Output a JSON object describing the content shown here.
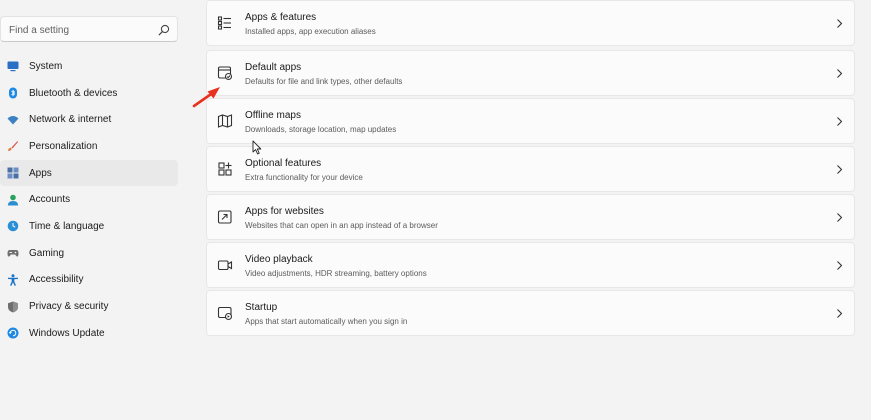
{
  "search": {
    "placeholder": "Find a setting",
    "icon": "search-icon"
  },
  "sidebar": {
    "items": [
      {
        "label": "System",
        "icon": "monitor-icon",
        "color": "#2a6fc4"
      },
      {
        "label": "Bluetooth & devices",
        "icon": "bluetooth-icon",
        "color": "#1e88e5"
      },
      {
        "label": "Network & internet",
        "icon": "wifi-icon",
        "color": "#3b82c4"
      },
      {
        "label": "Personalization",
        "icon": "brush-icon",
        "color": "#d9534f"
      },
      {
        "label": "Apps",
        "icon": "apps-icon",
        "color": "#4a6fa5",
        "active": true
      },
      {
        "label": "Accounts",
        "icon": "person-icon",
        "color": "#27a35f"
      },
      {
        "label": "Time & language",
        "icon": "globe-clock-icon",
        "color": "#2b8fd6"
      },
      {
        "label": "Gaming",
        "icon": "gamepad-icon",
        "color": "#707070"
      },
      {
        "label": "Accessibility",
        "icon": "accessibility-icon",
        "color": "#1a73c8"
      },
      {
        "label": "Privacy & security",
        "icon": "shield-icon",
        "color": "#6e6e6e"
      },
      {
        "label": "Windows Update",
        "icon": "update-icon",
        "color": "#1e88e5"
      }
    ]
  },
  "main": {
    "items": [
      {
        "title": "Apps & features",
        "subtitle": "Installed apps, app execution aliases",
        "icon": "apps-list-icon"
      },
      {
        "title": "Default apps",
        "subtitle": "Defaults for file and link types, other defaults",
        "icon": "default-apps-icon"
      },
      {
        "title": "Offline maps",
        "subtitle": "Downloads, storage location, map updates",
        "icon": "map-icon"
      },
      {
        "title": "Optional features",
        "subtitle": "Extra functionality for your device",
        "icon": "grid-plus-icon"
      },
      {
        "title": "Apps for websites",
        "subtitle": "Websites that can open in an app instead of a browser",
        "icon": "open-external-icon"
      },
      {
        "title": "Video playback",
        "subtitle": "Video adjustments, HDR streaming, battery options",
        "icon": "video-icon"
      },
      {
        "title": "Startup",
        "subtitle": "Apps that start automatically when you sign in",
        "icon": "startup-icon"
      }
    ]
  },
  "annotation": {
    "arrow_color": "#e8321f"
  }
}
